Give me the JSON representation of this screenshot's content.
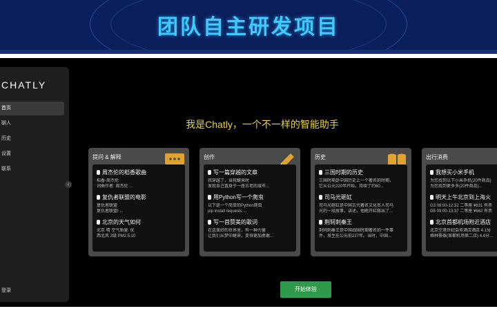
{
  "banner": {
    "title": "团队自主研发项目"
  },
  "sidebar": {
    "logo": "CHATLY",
    "items": [
      {
        "label": "首页",
        "active": true
      },
      {
        "label": "聊人",
        "active": false
      },
      {
        "label": "历史",
        "active": false
      },
      {
        "label": "设置",
        "active": false
      },
      {
        "label": "联系",
        "active": false
      }
    ],
    "logout": "登录"
  },
  "main": {
    "headline": "我是Chatly，一个不一样的智能助手",
    "cards": [
      {
        "title": "提问 & 解释",
        "icon": "chat-bubble-icon",
        "items": [
          {
            "title": "周杰伦的稻香歌曲",
            "desc1": "稻香-周杰伦",
            "desc2": "词曲作者: 周杰伦 ..."
          },
          {
            "title": "复仇者联盟的电影",
            "desc1": "复仇者联盟",
            "desc2": "复仇者联盟I ..."
          },
          {
            "title": "北京的天气如何",
            "desc1": "北京 晴 空气质量: 优",
            "desc2": "西北风 2级 PM2.5:10"
          }
        ]
      },
      {
        "title": "创作",
        "icon": "pencil-icon",
        "items": [
          {
            "title": "写一篇穿越的文章",
            "desc1": "我穿越了，当我醒来时",
            "desc2": "发现自己置身于一座古老的城市..."
          },
          {
            "title": "用Python写一个爬虫",
            "desc1": "以下是一个简单的Python爬虫",
            "desc2": "pip install requests ..."
          },
          {
            "title": "写一首赞美的歌词",
            "desc1": "在这美好的世界里，有一种力量",
            "desc2": "让我们从梦中醒来，变得更加勇敢..."
          }
        ]
      },
      {
        "title": "历史",
        "icon": "book-icon",
        "items": [
          {
            "title": "三国时期的历史",
            "desc1": "三国时期是中国历史上一个著名的时期，",
            "desc2": "它从公元220年开始，持续了约60..."
          },
          {
            "title": "司马光砸缸",
            "desc1": "司马光砸缸是中国古代著名文化名人司马",
            "desc2": "光的一段故事，讲述，他砸开缸救出了..."
          },
          {
            "title": "荆轲刺秦王",
            "desc1": "荆轲刺秦王是中国战国时期著名的一件事",
            "desc2": "件，发生在公元前227年。当时，中国..."
          }
        ]
      },
      {
        "title": "出行消费",
        "icon": "cart-icon",
        "items": [
          {
            "title": "我想买小米手机",
            "desc1": "为您找到以下小米手机(20件商品)",
            "desc2": "为您找到更多多(20件商品)..."
          },
          {
            "title": "明天上午北京到上海火",
            "desc1": "G3 08:00-12:32 二等座 ¥631 有票",
            "desc2": "G5 09:00-13:37 二等座 ¥662 有票"
          },
          {
            "title": "北京首都机场附近酒店",
            "desc1": "北京空港世纪会务酒店酒店 4.1分",
            "desc2": "格林豪泰(首都机场第二店) 4.4分..."
          }
        ]
      }
    ],
    "start_button": "开始体验"
  }
}
